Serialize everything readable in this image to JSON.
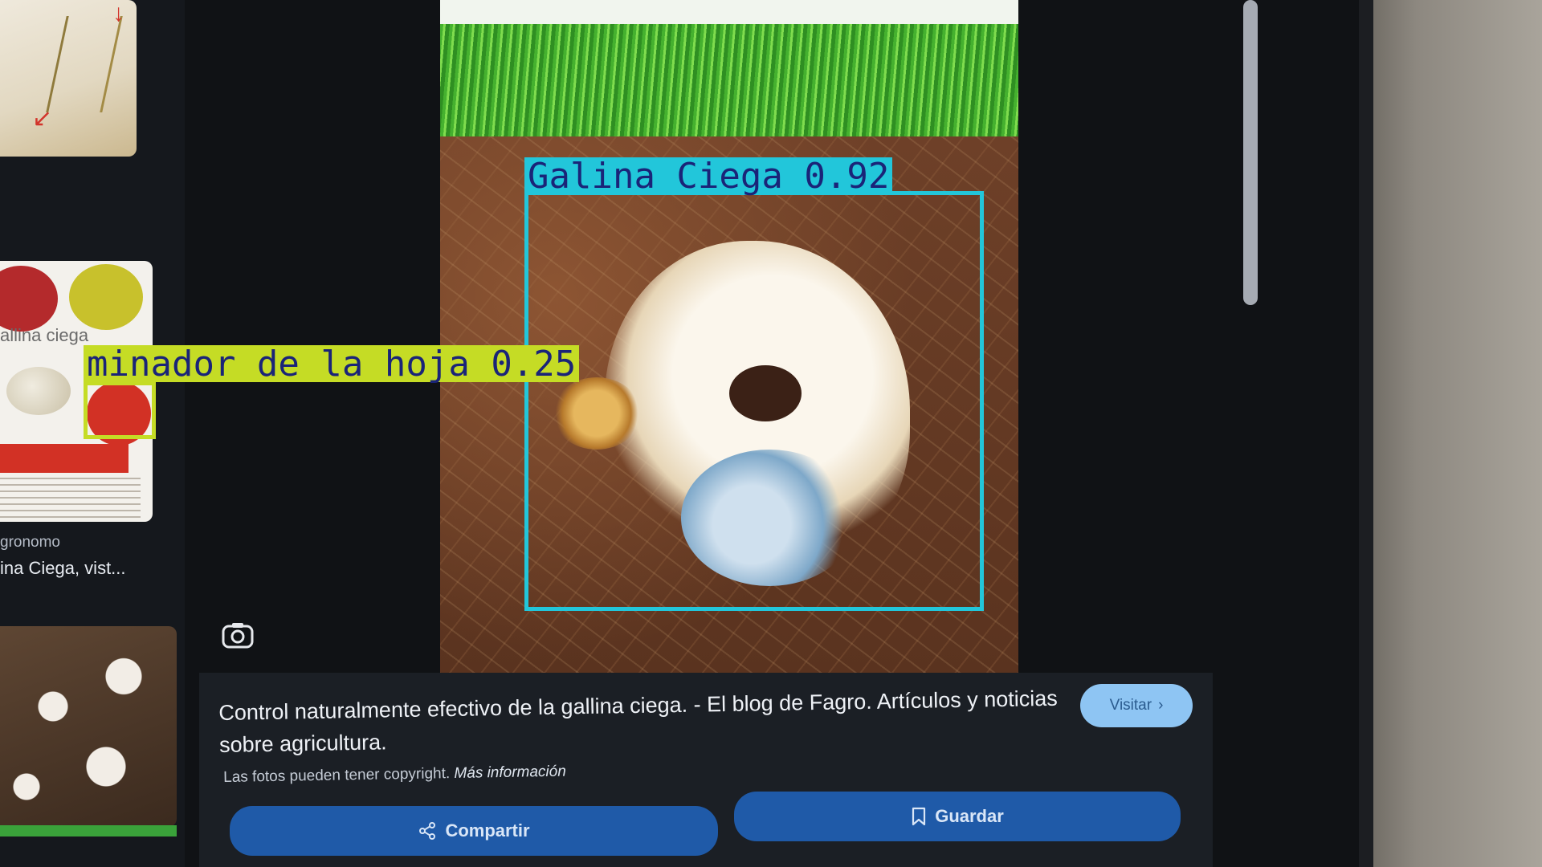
{
  "sidebar": {
    "thumbnail_1": {
      "label": ""
    },
    "thumbnail_2": {
      "heading": "allina ciega"
    },
    "source": "gronomo",
    "title": "ina Ciega, vist..."
  },
  "main_image": {
    "icon": "lens-icon"
  },
  "detections": [
    {
      "label": "Galina Ciega 0.92",
      "color": "#22c6da"
    },
    {
      "label": "minador de la hoja 0.25",
      "color": "#c5dc25"
    }
  ],
  "info": {
    "title": "Control naturalmente efectivo de la gallina ciega. - El blog de Fagro. Artículos y noticias sobre agricultura.",
    "visit_label": "Visitar",
    "copyright_text": "Las fotos pueden tener copyright.",
    "more_info_link": "Más información",
    "share_label": "Compartir",
    "save_label": "Guardar"
  },
  "colors": {
    "accent_button": "#1f5aa8",
    "visit_button": "#8ec5f3"
  }
}
